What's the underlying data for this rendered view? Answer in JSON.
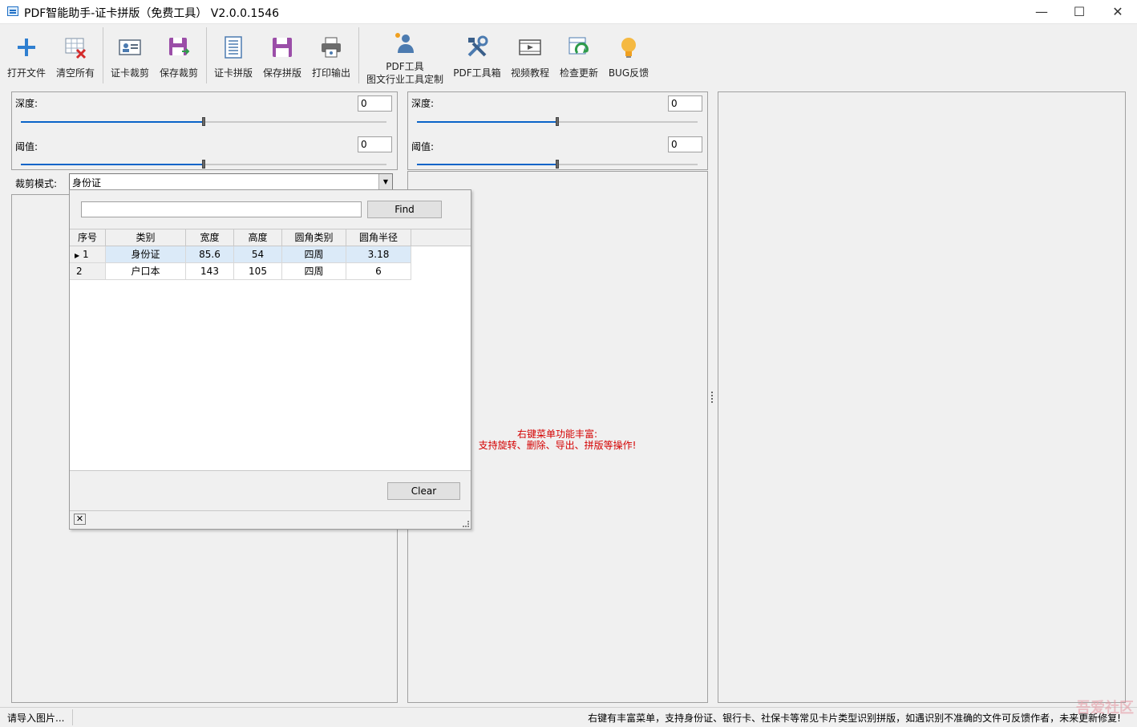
{
  "window": {
    "title": "PDF智能助手-证卡拼版（免费工具） V2.0.0.1546",
    "min": "—",
    "max": "☐",
    "close": "✕"
  },
  "toolbar": {
    "open": "打开文件",
    "clear_all": "清空所有",
    "card_crop": "证卡裁剪",
    "save_crop": "保存裁剪",
    "card_layout": "证卡拼版",
    "save_layout": "保存拼版",
    "print": "打印输出",
    "pdf_custom_line1": "PDF工具",
    "pdf_custom_line2": "图文行业工具定制",
    "pdf_toolbox": "PDF工具箱",
    "video": "视频教程",
    "update": "检查更新",
    "bug": "BUG反馈"
  },
  "left_panel": {
    "depth_label": "深度:",
    "depth_value": "0",
    "depth_level": 0.5,
    "threshold_label": "阈值:",
    "threshold_value": "0",
    "threshold_level": 0.5,
    "crop_mode_label": "裁剪模式:",
    "crop_mode_value": "身份证"
  },
  "mid_panel": {
    "depth_label": "深度:",
    "depth_value": "0",
    "depth_level": 0.5,
    "threshold_label": "阈值:",
    "threshold_value": "0",
    "threshold_level": 0.5,
    "hint_line1": "右键菜单功能丰富:",
    "hint_line2": "支持旋转、删除、导出、拼版等操作!"
  },
  "dropdown": {
    "find_button": "Find",
    "clear_button": "Clear",
    "search_value": "",
    "columns": [
      "序号",
      "类别",
      "宽度",
      "高度",
      "圆角类别",
      "圆角半径"
    ],
    "rows": [
      [
        "1",
        "身份证",
        "85.6",
        "54",
        "四周",
        "3.18"
      ],
      [
        "2",
        "户口本",
        "143",
        "105",
        "四周",
        "6"
      ]
    ]
  },
  "status": {
    "left": "请导入图片...",
    "right": "右键有丰富菜单，支持身份证、银行卡、社保卡等常见卡片类型识别拼版，如遇识别不准确的文件可反馈作者，未来更新修复!"
  },
  "watermark": "吾爱社区",
  "colors": {
    "accent": "#0a64c8",
    "hint": "#d40000",
    "selected_row": "#dbeaf8"
  }
}
